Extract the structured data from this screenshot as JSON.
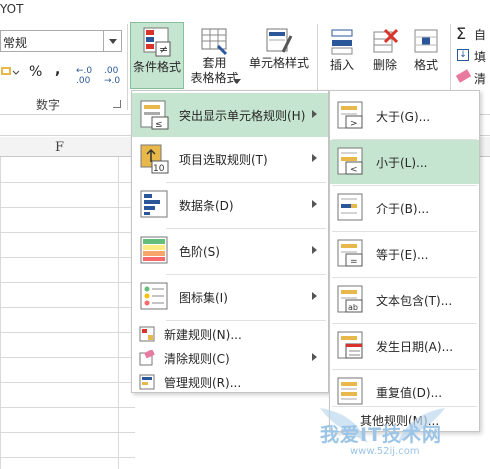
{
  "title_fragment": "YOT",
  "ribbon": {
    "number_format_value": "常规",
    "percent_symbol": "%",
    "comma_symbol": ",",
    "increase_decimal": "←.0 .00",
    "decrease_decimal": ".00 →.0",
    "number_group_label": "数字",
    "buttons": {
      "conditional_format": "条件格式",
      "table_format_line1": "套用",
      "table_format_line2": "表格格式",
      "cell_style": "单元格样式",
      "insert": "插入",
      "delete": "删除",
      "format": "格式"
    },
    "right_items": [
      "自",
      "填",
      "清"
    ]
  },
  "sheet": {
    "column_f": "F"
  },
  "menu1": {
    "items": [
      {
        "label": "突出显示单元格规则(H)"
      },
      {
        "label": "项目选取规则(T)"
      },
      {
        "label": "数据条(D)"
      },
      {
        "label": "色阶(S)"
      },
      {
        "label": "图标集(I)"
      },
      {
        "label": "新建规则(N)..."
      },
      {
        "label": "清除规则(C)"
      },
      {
        "label": "管理规则(R)..."
      }
    ]
  },
  "menu2": {
    "items": [
      {
        "label": "大于(G)..."
      },
      {
        "label": "小于(L)..."
      },
      {
        "label": "介于(B)..."
      },
      {
        "label": "等于(E)..."
      },
      {
        "label": "文本包含(T)..."
      },
      {
        "label": "发生日期(A)..."
      },
      {
        "label": "重复值(D)..."
      },
      {
        "label": "其他规则(M)..."
      }
    ]
  },
  "watermark": {
    "text": "我爱IT技术网",
    "url": "www.52ij.com"
  },
  "colors": {
    "highlight": "#c6e5d0",
    "accent": "#2b579a"
  }
}
